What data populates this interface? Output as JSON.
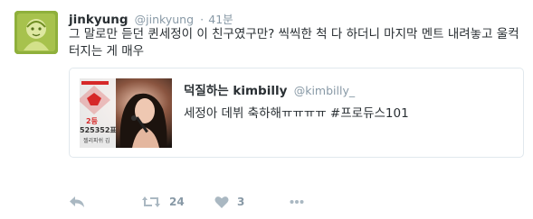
{
  "tweet": {
    "author_name": "jinkyung",
    "author_handle": "@jinkyung",
    "separator": "·",
    "time": "41분",
    "text": "그 말로만 듣던 퀸세정이 이 친구였구만? 씩씩한 척 다 하더니 마지막 멘트 내려놓고 울컥 터지는 게 매우",
    "avatar_icon": "avatar-illustration"
  },
  "quoted": {
    "author_name": "덕질하는 kimbilly",
    "author_handle": "@kimbilly_",
    "text": "세정아 데뷔 축하해ㅠㅠㅠㅠ #프로듀스101",
    "thumbnail": {
      "rank_label": "2등",
      "votes_label": "525352표",
      "caption_label": "젤리피쉬 김"
    }
  },
  "actions": {
    "reply_icon": "reply-icon",
    "retweet_icon": "retweet-icon",
    "retweet_count": "24",
    "like_icon": "heart-icon",
    "like_count": "3",
    "more_icon": "more-icon"
  },
  "colors": {
    "text": "#292f33",
    "secondary": "#8899a6",
    "border": "#e1e8ed",
    "icon": "#aab8c2",
    "rank_red": "#d62828"
  }
}
